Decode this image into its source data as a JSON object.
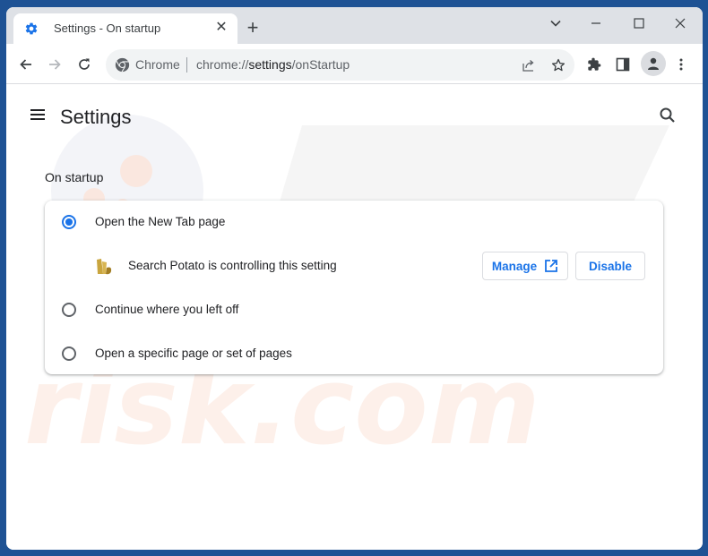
{
  "browser": {
    "tab": {
      "title": "Settings - On startup",
      "icon": "gear-icon",
      "close_label": "✕"
    },
    "new_tab_label": "+",
    "window_controls": [
      "tab-search",
      "minimize",
      "maximize",
      "close"
    ],
    "omnibox": {
      "site_label": "Chrome",
      "url_prefix": "chrome://",
      "url_host": "settings",
      "url_path": "/onStartup"
    }
  },
  "settings": {
    "title": "Settings",
    "section_title": "On startup",
    "options": [
      {
        "label": "Open the New Tab page",
        "checked": true
      },
      {
        "label": "Continue where you left off",
        "checked": false
      },
      {
        "label": "Open a specific page or set of pages",
        "checked": false
      }
    ],
    "extension_notice": {
      "text": "Search Potato is controlling this setting",
      "manage_label": "Manage",
      "disable_label": "Disable"
    }
  },
  "colors": {
    "accent": "#1a73e8",
    "frame": "#dee1e6",
    "desktop": "#1e5294"
  }
}
